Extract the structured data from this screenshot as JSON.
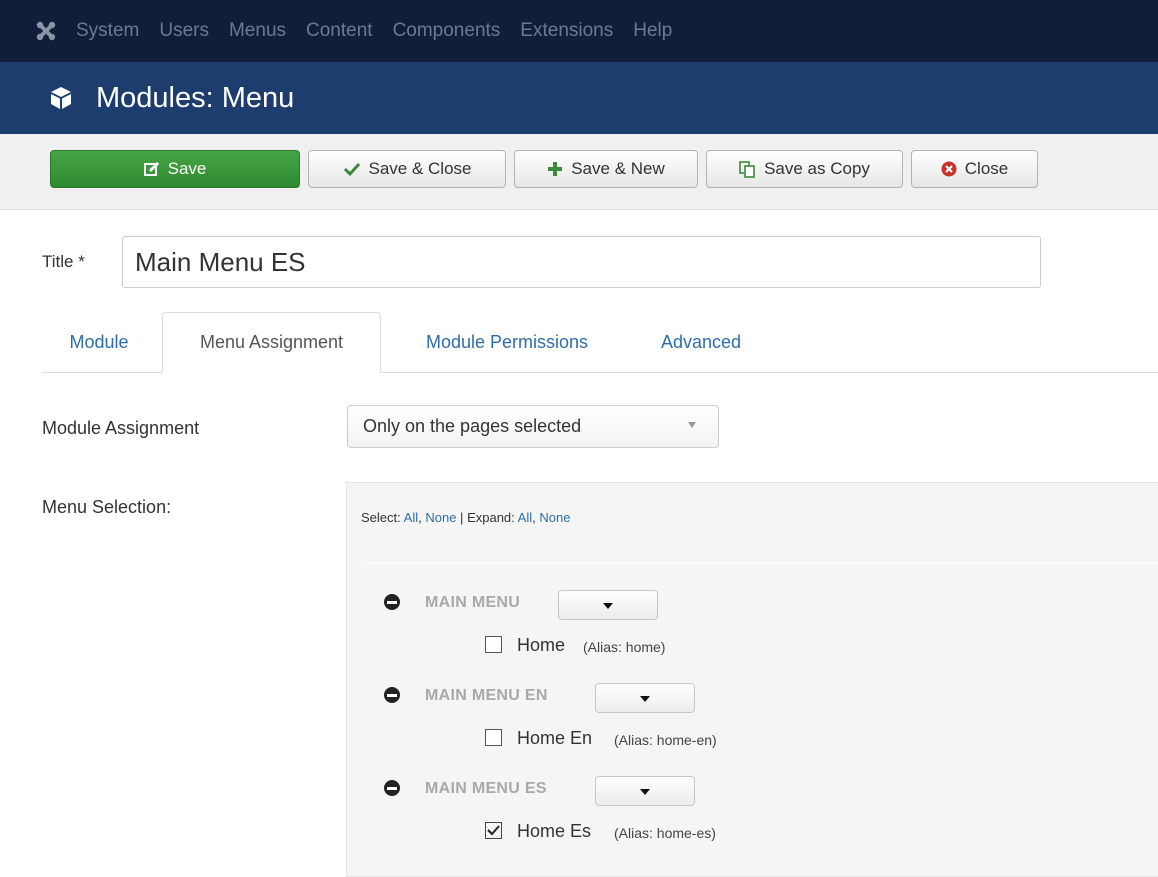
{
  "topnav": {
    "items": [
      "System",
      "Users",
      "Menus",
      "Content",
      "Components",
      "Extensions",
      "Help"
    ],
    "logo_icon": "joomla-logo-icon"
  },
  "header": {
    "title": "Modules: Menu",
    "icon": "cube-icon"
  },
  "toolbar": {
    "save": "Save",
    "save_close": "Save & Close",
    "save_new": "Save & New",
    "save_copy": "Save as Copy",
    "close": "Close"
  },
  "form": {
    "title_label": "Title *",
    "title_value": "Main Menu ES"
  },
  "tabs": [
    "Module",
    "Menu Assignment",
    "Module Permissions",
    "Advanced"
  ],
  "active_tab": "Menu Assignment",
  "assignment": {
    "label": "Module Assignment",
    "selected": "Only on the pages selected"
  },
  "menu_selection": {
    "label": "Menu Selection:",
    "select_label": "Select:",
    "all": "All",
    "none": "None",
    "separator": "|",
    "expand_label": "Expand:",
    "menus": [
      {
        "name": "MAIN MENU",
        "item": "Home",
        "alias": "(Alias: home)",
        "checked": false
      },
      {
        "name": "MAIN MENU EN",
        "item": "Home En",
        "alias": "(Alias: home-en)",
        "checked": false
      },
      {
        "name": "MAIN MENU ES",
        "item": "Home Es",
        "alias": "(Alias: home-es)",
        "checked": true
      }
    ]
  },
  "colors": {
    "topnav_bg": "#0f1f3a",
    "header_bg": "#1c3d6e",
    "save_green": "#3d9a3d",
    "link_blue": "#2f6ea9",
    "close_red": "#c9302c"
  }
}
